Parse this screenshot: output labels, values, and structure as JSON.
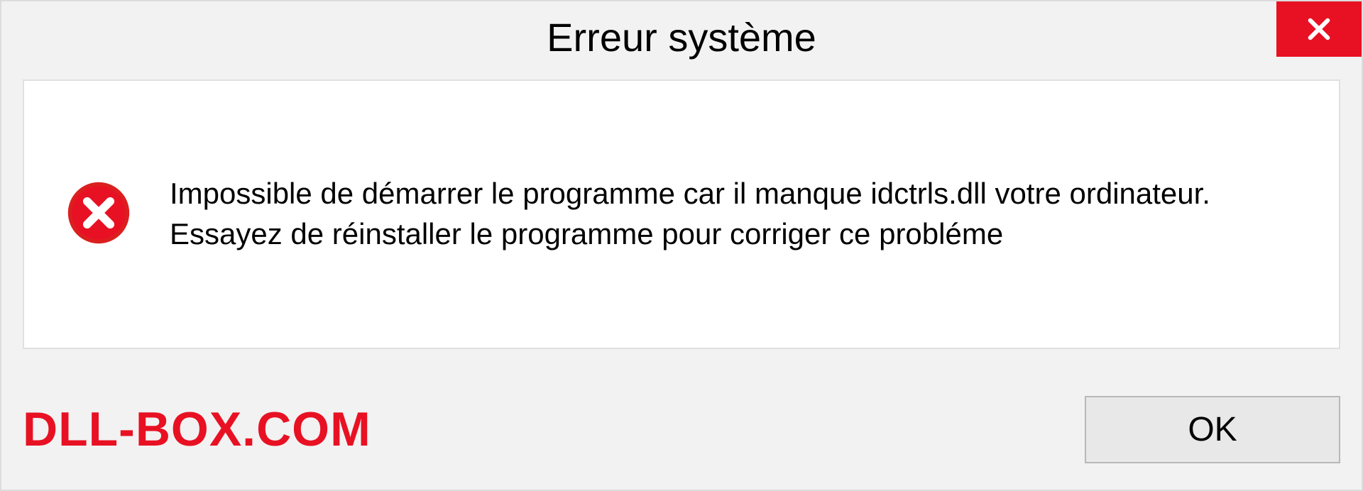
{
  "dialog": {
    "title": "Erreur système",
    "message": "Impossible de démarrer le programme car il manque idctrls.dll votre ordinateur. Essayez de réinstaller le programme pour corriger ce probléme",
    "ok_label": "OK"
  },
  "brand": {
    "text": "DLL-BOX.COM"
  },
  "colors": {
    "accent_red": "#e81123",
    "background": "#f2f2f2",
    "panel": "#ffffff"
  },
  "icons": {
    "close": "close-icon",
    "error": "error-circle-x-icon"
  }
}
